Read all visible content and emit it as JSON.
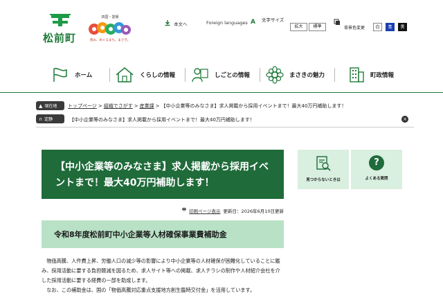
{
  "header": {
    "town_name": "松前町",
    "mascot_top": "四国・愛媛",
    "mascot_bottom": "恵み、めぐるまち。まさき。",
    "honbun": "本文へ",
    "foreign": "Foreign languages",
    "moji_icon": "A",
    "moji_label": "文字サイズ",
    "size_large": "拡大",
    "size_standard": "標準",
    "bg_label": "背景色変更",
    "color_white": "白",
    "color_blue": "青",
    "color_black": "黒"
  },
  "nav": [
    {
      "label": "ホーム",
      "icon": "flag-icon"
    },
    {
      "label": "くらしの情報",
      "icon": "house-icon"
    },
    {
      "label": "しごとの情報",
      "icon": "worker-icon"
    },
    {
      "label": "まさきの魅力",
      "icon": "flower-icon"
    },
    {
      "label": "町政情報",
      "icon": "building-icon"
    }
  ],
  "breadcrumb": {
    "current_tag": "現在地",
    "fixed_tag": "定静",
    "items": [
      "トップページ",
      "組織でさがす",
      "産業課"
    ],
    "current": "【中小企業等のみなさま】求人掲載から採用イベントまで！最大40万円補助します！",
    "fixed_text": "【中小企業等のみなさま】求人掲載から採用イベントまで！最大40万円補助します！"
  },
  "article": {
    "title": "【中小企業等のみなさま】求人掲載から採用イベントまで！最大40万円補助します！",
    "print_label": "印刷ページ表示",
    "updated": "更新日：2026年6月10日更新",
    "subtitle": "令和8年度松前町中小企業等人材確保事業費補助金",
    "para1": "物価高騰、人件費上昇、労働人口の減少等の影響により中小企業等の人材確保が困難化していることに鑑み、採用活動に要する負担軽減を図るため、求人サイト等への掲載、求人チラシの制作や人材紹介会社を介した採用活動に要する経費の一部を助成します。",
    "para2": "なお、この補助金は、国の「物価高騰対応重点支援地方創生臨時交付金」を活用しています。"
  },
  "side": {
    "notfound_label": "見つからないときは",
    "faq_label": "よくある質問",
    "faq_glyph": "?"
  },
  "colors": {
    "brand_green": "#1f6b3a",
    "sub_green": "#b8e1c5",
    "side_green": "#d9efe0"
  }
}
